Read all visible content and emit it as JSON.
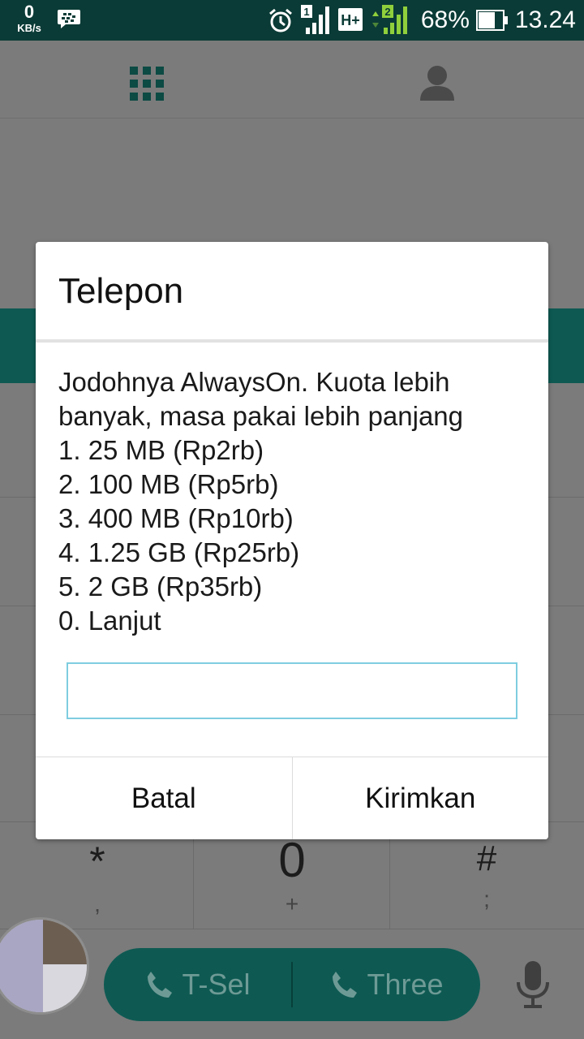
{
  "status_bar": {
    "net_speed_value": "0",
    "net_speed_unit": "KB/s",
    "sim1_label": "1",
    "sim2_label": "2",
    "network_type": "H+",
    "battery_percent": "68%",
    "time": "13.24"
  },
  "dialer": {
    "keys_bottom_row": [
      {
        "main": "*",
        "sub": ","
      },
      {
        "main": "0",
        "sub": "+"
      },
      {
        "main": "#",
        "sub": ";"
      }
    ],
    "call_buttons": [
      {
        "label": "T-Sel"
      },
      {
        "label": "Three"
      }
    ]
  },
  "dialog": {
    "title": "Telepon",
    "message_lines": [
      "Jodohnya AlwaysOn. Kuota lebih banyak, masa pakai lebih panjang",
      "1. 25 MB (Rp2rb)",
      "2. 100 MB (Rp5rb)",
      "3. 400 MB (Rp10rb)",
      "4. 1.25 GB (Rp25rb)",
      "5. 2 GB (Rp35rb)",
      "0. Lanjut"
    ],
    "input_value": "",
    "cancel_label": "Batal",
    "send_label": "Kirimkan"
  },
  "colors": {
    "status_bar_bg": "#0b3b36",
    "teal_accent": "#0e5a53",
    "input_border": "#7fcde0"
  }
}
